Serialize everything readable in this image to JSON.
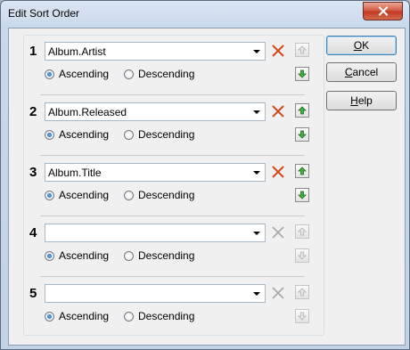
{
  "window": {
    "title": "Edit Sort Order"
  },
  "rows": [
    {
      "number": "1",
      "field": "Album.Artist",
      "ascending_label": "Ascending",
      "descending_label": "Descending",
      "order": "ascending",
      "remove_enabled": true,
      "up_enabled": false,
      "down_enabled": true
    },
    {
      "number": "2",
      "field": "Album.Released",
      "ascending_label": "Ascending",
      "descending_label": "Descending",
      "order": "ascending",
      "remove_enabled": true,
      "up_enabled": true,
      "down_enabled": true
    },
    {
      "number": "3",
      "field": "Album.Title",
      "ascending_label": "Ascending",
      "descending_label": "Descending",
      "order": "ascending",
      "remove_enabled": true,
      "up_enabled": true,
      "down_enabled": true
    },
    {
      "number": "4",
      "field": "",
      "ascending_label": "Ascending",
      "descending_label": "Descending",
      "order": "ascending",
      "remove_enabled": false,
      "up_enabled": false,
      "down_enabled": false
    },
    {
      "number": "5",
      "field": "",
      "ascending_label": "Ascending",
      "descending_label": "Descending",
      "order": "ascending",
      "remove_enabled": false,
      "up_enabled": false,
      "down_enabled": false
    }
  ],
  "buttons": {
    "ok": {
      "label": "OK",
      "mnemonic": "O"
    },
    "cancel": {
      "label": "Cancel",
      "mnemonic": "C"
    },
    "help": {
      "label": "Help",
      "mnemonic": "H"
    }
  },
  "colors": {
    "remove_active": "#d24a1c",
    "remove_disabled": "#a8a8a8",
    "arrow_active": "#2e9b2a",
    "arrow_disabled": "#b0b0b0"
  }
}
